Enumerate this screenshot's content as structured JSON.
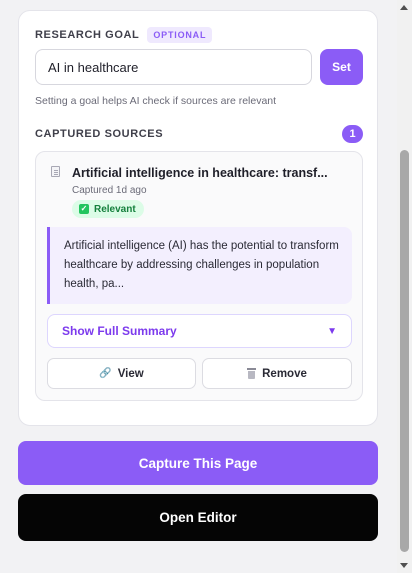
{
  "goal": {
    "title": "RESEARCH GOAL",
    "badge": "OPTIONAL",
    "input_value": "AI in healthcare",
    "set_label": "Set",
    "helper": "Setting a goal helps AI check if sources are relevant"
  },
  "sources": {
    "title": "CAPTURED SOURCES",
    "count": "1",
    "items": [
      {
        "icon": "document-icon",
        "title": "Artificial intelligence in healthcare: transf...",
        "captured": "Captured 1d ago",
        "status": "Relevant",
        "status_color": "#15803d",
        "summary": "Artificial intelligence (AI) has the potential to transform healthcare by addressing challenges in population health, pa...",
        "toggle_label": "Show Full Summary",
        "view_label": "View",
        "remove_label": "Remove"
      }
    ]
  },
  "actions": {
    "capture_label": "Capture This Page",
    "editor_label": "Open Editor"
  },
  "colors": {
    "accent": "#8b5cf6",
    "dark": "#050505"
  }
}
